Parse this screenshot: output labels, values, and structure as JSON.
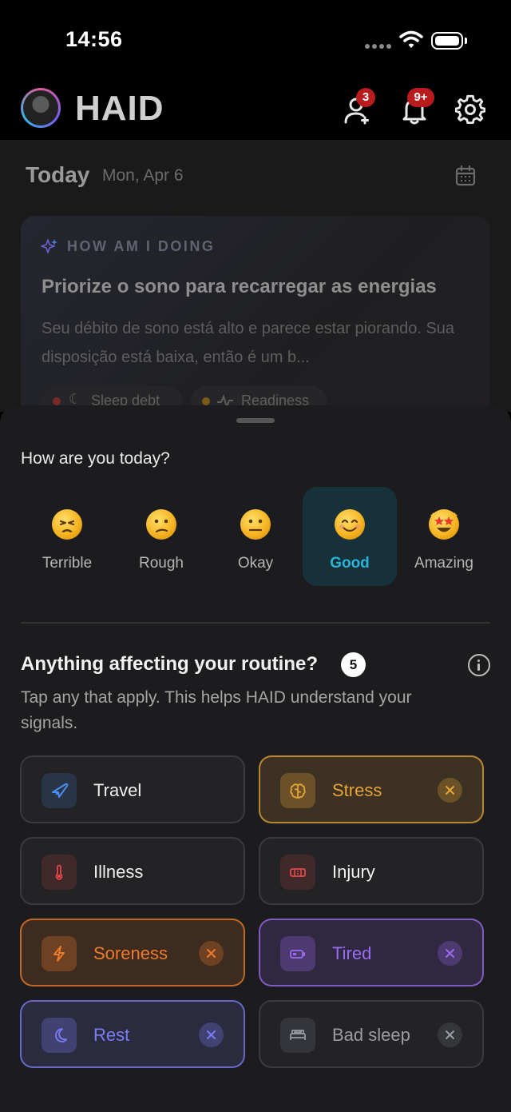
{
  "status": {
    "time": "14:56"
  },
  "header": {
    "logo": "HAID",
    "people_badge": "3",
    "bell_badge": "9+"
  },
  "page": {
    "today": "Today",
    "date": "Mon, Apr 6",
    "card": {
      "kicker": "HOW AM I DOING",
      "title": "Priorize o sono para recarregar as energias",
      "body": "Seu débito de sono está alto e parece estar piorando. Sua disposição está baixa, então é um b...",
      "chips": [
        "Sleep debt",
        "Readiness"
      ]
    }
  },
  "sheet": {
    "mood_question": "How are you today?",
    "moods": [
      {
        "label": "Terrible",
        "selected": false
      },
      {
        "label": "Rough",
        "selected": false
      },
      {
        "label": "Okay",
        "selected": false
      },
      {
        "label": "Good",
        "selected": true
      },
      {
        "label": "Amazing",
        "selected": false
      }
    ],
    "routine_question": "Anything affecting your routine?",
    "selected_count": "5",
    "help_text": "Tap any that apply. This helps HAID understand your signals.",
    "factors": [
      {
        "label": "Travel",
        "icon": "plane-icon",
        "selected": false,
        "color": "#4a8ff0"
      },
      {
        "label": "Stress",
        "icon": "brain-icon",
        "selected": true,
        "color": "#e7a43a"
      },
      {
        "label": "Illness",
        "icon": "thermometer-icon",
        "selected": false,
        "color": "#e04848"
      },
      {
        "label": "Injury",
        "icon": "bandage-icon",
        "selected": false,
        "color": "#e04848"
      },
      {
        "label": "Soreness",
        "icon": "bolt-icon",
        "selected": true,
        "color": "#ef7b2a"
      },
      {
        "label": "Tired",
        "icon": "battery-low-icon",
        "selected": true,
        "color": "#9b6cf0"
      },
      {
        "label": "Rest",
        "icon": "moon-icon",
        "selected": true,
        "color": "#7b7cf5"
      },
      {
        "label": "Bad sleep",
        "icon": "bed-icon",
        "selected": true,
        "color": "#9a9ca3"
      }
    ]
  },
  "colors": {
    "accent_good": "#2bb3d6",
    "sheet_bg": "#1c1c1e",
    "badge": "#b91c1c"
  }
}
